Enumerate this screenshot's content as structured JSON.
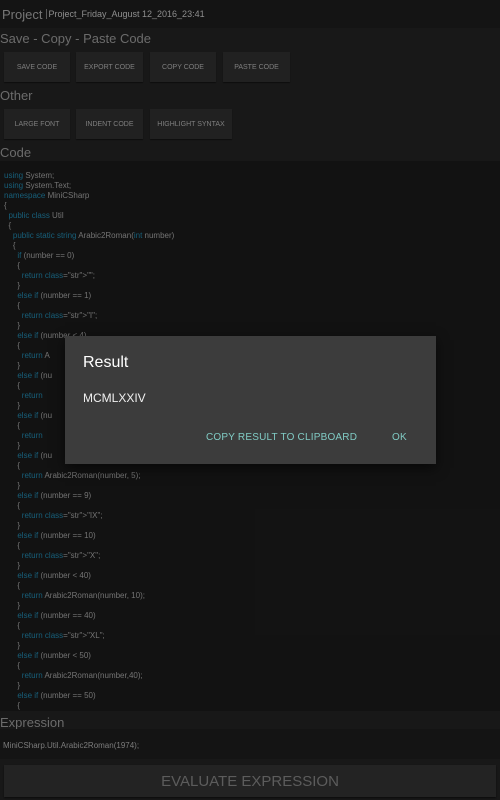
{
  "header": {
    "project_label": "Project",
    "project_name": "Project_Friday_August 12_2016_23:41"
  },
  "sections": {
    "save_copy_paste": "Save - Copy - Paste Code",
    "other": "Other",
    "code": "Code",
    "expression": "Expression"
  },
  "buttons": {
    "save_code": "SAVE CODE",
    "export_code": "EXPORT CODE",
    "copy_code": "COPY CODE",
    "paste_code": "PASTE CODE",
    "large_font": "LARGE FONT",
    "indent_code": "INDENT CODE",
    "highlight_syntax": "HIGHLIGHT SYNTAX"
  },
  "code_lines": [
    "using System;",
    "using System.Text;",
    "namespace MiniCSharp",
    "{",
    "  public class Util",
    "  {",
    "    public static string Arabic2Roman(int number)",
    "    {",
    "      if (number == 0)",
    "      {",
    "        return \"\";",
    "      }",
    "      else if (number == 1)",
    "      {",
    "        return \"I\";",
    "      }",
    "      else if (number < 4)",
    "      {",
    "        return A",
    "      }",
    "      else if (nu",
    "      {",
    "        return",
    "      }",
    "      else if (nu",
    "      {",
    "        return",
    "      }",
    "      else if (nu",
    "      {",
    "        return Arabic2Roman(number, 5);",
    "      }",
    "      else if (number == 9)",
    "      {",
    "        return \"IX\";",
    "      }",
    "      else if (number == 10)",
    "      {",
    "        return \"X\";",
    "      }",
    "      else if (number < 40)",
    "      {",
    "        return Arabic2Roman(number, 10);",
    "      }",
    "      else if (number == 40)",
    "      {",
    "        return \"XL\";",
    "      }",
    "      else if (number < 50)",
    "      {",
    "        return Arabic2Roman(number,40);",
    "      }",
    "      else if (number == 50)",
    "      {"
  ],
  "expression": {
    "value": "MiniCSharp.Util.Arabic2Roman(1974);"
  },
  "evaluate_button": "EVALUATE EXPRESSION",
  "dialog": {
    "title": "Result",
    "message": "MCMLXXIV",
    "copy_button": "COPY RESULT TO CLIPBOARD",
    "ok_button": "OK"
  },
  "colors": {
    "accent": "#80cbc4",
    "keyword": "#1f7fa3",
    "string": "#8b2d2d",
    "background": "#212121"
  }
}
